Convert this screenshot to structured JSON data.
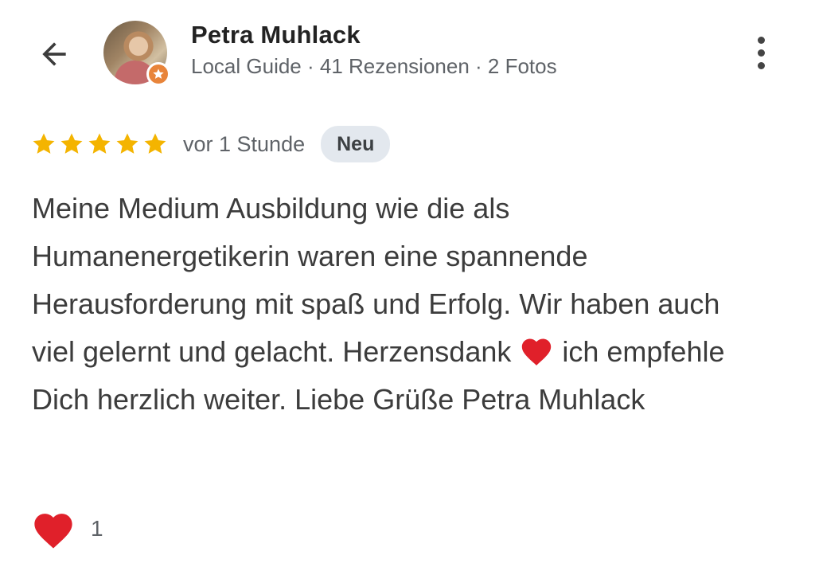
{
  "header": {
    "back_icon": "arrow-left-icon",
    "user_name": "Petra Muhlack",
    "user_meta": "Local Guide · 41 Rezensionen · 2 Fotos",
    "badge_icon": "local-guide-star-icon",
    "more_icon": "more-vertical-icon"
  },
  "review": {
    "rating": 5,
    "rating_max": 5,
    "time": "vor 1 Stunde",
    "badge": "Neu",
    "text_part1": "Meine Medium Ausbildung wie die als Humanenergetikerin waren eine spannende Herausforderung mit spaß und Erfolg. Wir haben auch viel gelernt und gelacht. Herzensdank ",
    "text_part2": " ich empfehle Dich herzlich weiter. Liebe Grüße Petra Muhlack"
  },
  "reactions": {
    "icon": "heart-icon",
    "count": "1"
  },
  "colors": {
    "star": "#f4b400",
    "heart": "#e0202a",
    "badge_bg": "#e3e8ee",
    "guide_badge": "#e8843a",
    "meta_text": "#5f6368"
  }
}
